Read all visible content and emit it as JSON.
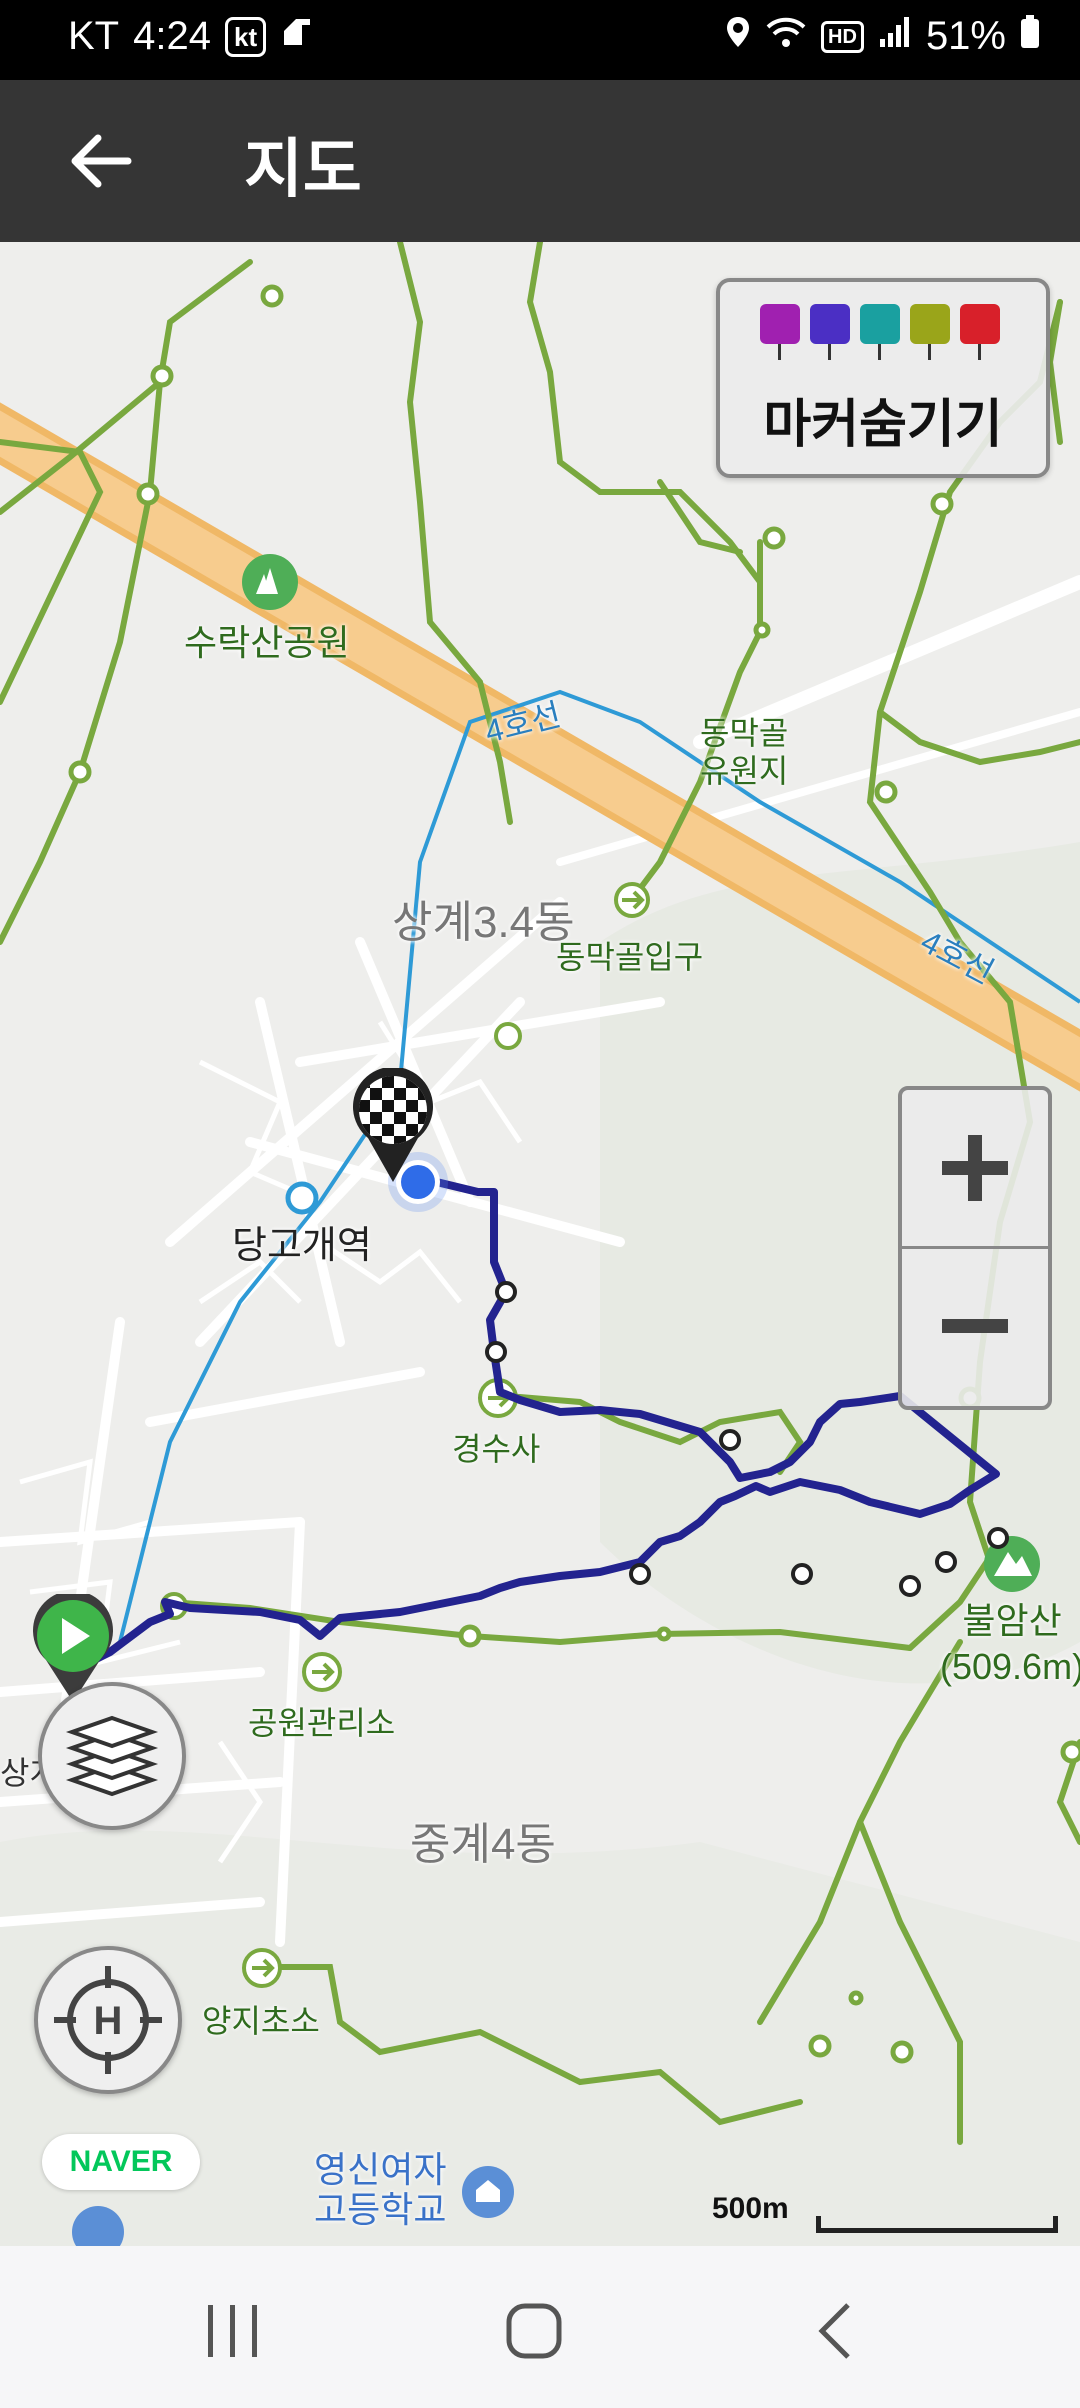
{
  "status_bar": {
    "carrier": "KT",
    "time": "4:24",
    "carrier_badge": "kt",
    "hd_badge": "HD",
    "battery": "51%"
  },
  "app_bar": {
    "title": "지도"
  },
  "marker_toggle": {
    "label": "마커숨기기",
    "icons": [
      {
        "name": "camera-icon",
        "color": "#a020b0"
      },
      {
        "name": "video-icon",
        "color": "#4b2fc4"
      },
      {
        "name": "pin-icon",
        "color": "#1aa0a0"
      },
      {
        "name": "note-icon",
        "color": "#9aa51a"
      },
      {
        "name": "flag-icon",
        "color": "#d8202a"
      }
    ]
  },
  "map": {
    "labels": {
      "park": "수락산공원",
      "line4_a": "4호선",
      "line4_b": "4호선",
      "dongmakgol": "동막골\n유원지",
      "sanggye34": "상계3.4동",
      "dongmakgol_entrance": "동막골입구",
      "danggogae": "당고개역",
      "gyeongsusa": "경수사",
      "bulamsan": "불암산\n(509.6m)",
      "park_office": "공원관리소",
      "junggye4": "중계4동",
      "yangji": "양지초소",
      "school": "영신여자\n고등학교",
      "sanggye_edge": "상계"
    },
    "naver": "NAVER",
    "scale_label": "500m"
  },
  "nav_bar": {
    "recent": "recent-apps",
    "home": "home",
    "back": "back"
  }
}
